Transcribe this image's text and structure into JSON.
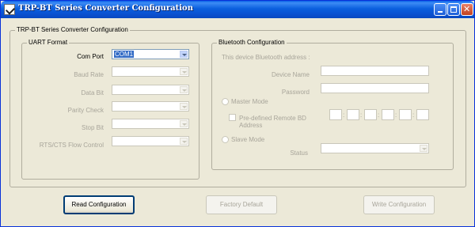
{
  "window": {
    "title": "TRP-BT Series Converter Configuration"
  },
  "main_group": {
    "title": "TRP-BT Series Converter Configuration"
  },
  "uart": {
    "title": "UART Format",
    "com_port": {
      "label": "Com Port",
      "value": "COM1"
    },
    "baud_rate": {
      "label": "Baud Rate",
      "value": ""
    },
    "data_bit": {
      "label": "Data Bit",
      "value": ""
    },
    "parity_check": {
      "label": "Parity Check",
      "value": ""
    },
    "stop_bit": {
      "label": "Stop Bit",
      "value": ""
    },
    "flow_control": {
      "label": "RTS/CTS Flow Control",
      "value": ""
    }
  },
  "bluetooth": {
    "title": "Bluetooth Configuration",
    "address_label": "This device Bluetooth address :",
    "device_name_label": "Device Name",
    "device_name_value": "",
    "password_label": "Password",
    "password_value": "",
    "master_mode_label": "Master Mode",
    "predefined_label": "Pre-defined Remote BD Address",
    "bd_separator": ":",
    "slave_mode_label": "Slave Mode",
    "status_label": "Status",
    "status_value": ""
  },
  "buttons": {
    "read": "Read Configuration",
    "factory": "Factory Default",
    "write": "Write Configuration"
  }
}
